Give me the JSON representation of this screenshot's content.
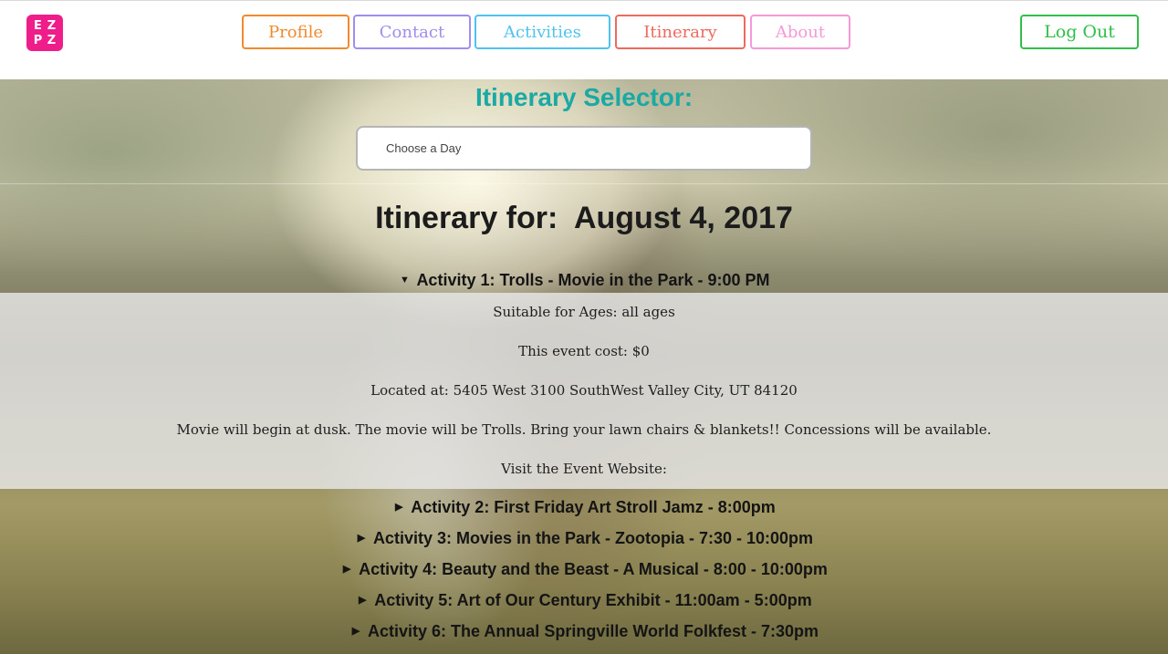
{
  "logo": {
    "letters": [
      "E",
      "Z",
      "P",
      "Z"
    ],
    "background_color": "#ee1d8a"
  },
  "nav": {
    "items": [
      {
        "label": "Profile",
        "color": "#f08a2c"
      },
      {
        "label": "Contact",
        "color": "#a18cf0"
      },
      {
        "label": "Activities",
        "color": "#4fc3ee"
      },
      {
        "label": "Itinerary",
        "color": "#ee6a5f"
      },
      {
        "label": "About",
        "color": "#f59ad6"
      }
    ],
    "logout": {
      "label": "Log Out",
      "color": "#2fbf4a"
    }
  },
  "selector": {
    "title": "Itinerary Selector:",
    "placeholder": "Choose a Day"
  },
  "itinerary": {
    "heading": "Itinerary for:  August 4, 2017",
    "expanded_icon": "caret-down-icon",
    "collapsed_icon": "caret-right-icon",
    "activities": [
      {
        "label": "Activity 1: Trolls - Movie in the Park - 9:00 PM",
        "expanded": true
      },
      {
        "label": "Activity 2: First Friday Art Stroll Jamz - 8:00pm",
        "expanded": false
      },
      {
        "label": "Activity 3: Movies in the Park - Zootopia - 7:30 - 10:00pm",
        "expanded": false
      },
      {
        "label": "Activity 4: Beauty and the Beast - A Musical - 8:00 - 10:00pm",
        "expanded": false
      },
      {
        "label": "Activity 5: Art of Our Century Exhibit - 11:00am - 5:00pm",
        "expanded": false
      },
      {
        "label": "Activity 6: The Annual Springville World Folkfest - 7:30pm",
        "expanded": false
      }
    ],
    "details": {
      "ages": "Suitable for Ages: all ages",
      "cost": "This event cost: $0",
      "location": "Located at: 5405 West 3100 SouthWest Valley City, UT 84120",
      "description": "Movie will begin at dusk. The movie will be Trolls. Bring your lawn chairs & blankets!! Concessions will be available.",
      "website": "Visit the Event Website:"
    }
  }
}
